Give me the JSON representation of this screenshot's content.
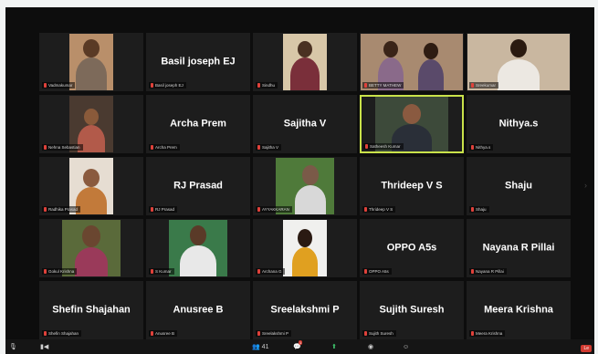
{
  "participants": [
    {
      "label": "Vadmakumar",
      "display": "",
      "video": true
    },
    {
      "label": "Basil joseph EJ",
      "display": "Basil joseph EJ",
      "video": false
    },
    {
      "label": "Sindhu",
      "display": "",
      "video": true
    },
    {
      "label": "BETTY MATHEW",
      "display": "",
      "video": true
    },
    {
      "label": "Sreekumar",
      "display": "",
      "video": true
    },
    {
      "label": "Nehna Sebastian",
      "display": "",
      "video": true
    },
    {
      "label": "Archa Prem",
      "display": "Archa Prem",
      "video": false
    },
    {
      "label": "Sajitha V",
      "display": "Sajitha V",
      "video": false
    },
    {
      "label": "Satheesh Kumar",
      "display": "",
      "video": true,
      "active": true
    },
    {
      "label": "Nithya.s",
      "display": "Nithya.s",
      "video": false
    },
    {
      "label": "Radhika Prasad",
      "display": "",
      "video": true
    },
    {
      "label": "RJ Prasad",
      "display": "RJ Prasad",
      "video": false
    },
    {
      "label": "AYYAKKARAN",
      "display": "",
      "video": true
    },
    {
      "label": "Thrideep V S",
      "display": "Thrideep V  S",
      "video": false
    },
    {
      "label": "Shaju",
      "display": "Shaju",
      "video": false
    },
    {
      "label": "Gokul Krishna",
      "display": "",
      "video": true
    },
    {
      "label": "S Kumar",
      "display": "",
      "video": true
    },
    {
      "label": "Archana G",
      "display": "",
      "video": true
    },
    {
      "label": "OPPO A5s",
      "display": "OPPO A5s",
      "video": false
    },
    {
      "label": "Nayana R Pillai",
      "display": "Nayana R Pillai",
      "video": false
    },
    {
      "label": "Shefin Shajahan",
      "display": "Shefin Shajahan",
      "video": false
    },
    {
      "label": "Anusree B",
      "display": "Anusree B",
      "video": false
    },
    {
      "label": "Sreelakshmi P",
      "display": "Sreelakshmi P",
      "video": false
    },
    {
      "label": "Sujith Suresh",
      "display": "Sujith Suresh",
      "video": false
    },
    {
      "label": "Meera Krishna",
      "display": "Meera Krishna",
      "video": false
    }
  ],
  "toolbar": {
    "participant_count": "41",
    "chat_badge": "1",
    "leave_label": "Le"
  },
  "colors": {
    "active_border": "#c9e24a",
    "tile_bg": "#1d1d1d",
    "muted": "#e0413a",
    "leave": "#d13a30"
  }
}
